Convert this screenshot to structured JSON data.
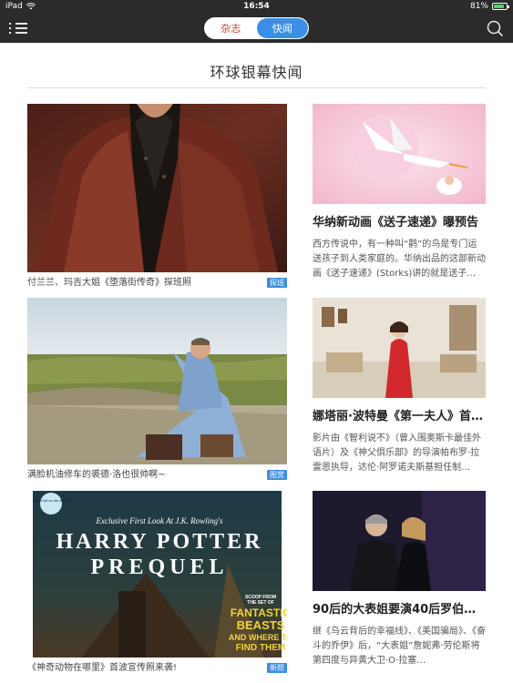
{
  "status": {
    "device": "iPad",
    "time": "16:54",
    "battery": "81%",
    "battery_level": 0.81
  },
  "nav": {
    "tab_magazine": "杂志",
    "tab_news": "快闻",
    "active_tab": "快闻"
  },
  "section": {
    "title": "环球银幕快闻"
  },
  "left_cards": [
    {
      "caption": "付兰兰、玛吉大姐《堕落街传奇》探班照",
      "tag": "探班"
    },
    {
      "caption": "满脸机油修车的裘德·洛也很帅啊~",
      "tag": "图赏"
    },
    {
      "caption": "《神奇动物在哪里》首波宣传照来袭!",
      "tag": "新照",
      "poster": {
        "badge": "Scoot kid on the Block!",
        "exclusive": "Exclusive First Look At J.K. Rowling's",
        "line1": "HARRY POTTER",
        "line2": "PREQUEL",
        "scoop1": "SCOOP FROM",
        "scoop2": "THE SET OF",
        "fb1": "FANTASTIC",
        "fb2": "BEASTS",
        "fb3": "AND WHERE TO",
        "fb4": "FIND THEM"
      }
    }
  ],
  "right_cards": [
    {
      "headline": "华纳新动画《送子速递》曝预告",
      "desc": "西方传说中，有一种叫“鹳”的鸟是专门运送孩子到人类家庭的。华纳出品的这部新动画《送子速递》(Storks)讲的就是送子…"
    },
    {
      "headline": "娜塔丽·波特曼《第一夫人》首…",
      "desc": "影片由《智利说不》（曾入围奥斯卡最佳外语片）及《神父俱乐部》的导演帕布罗·拉雷恩执导，达伦·阿罗诺夫斯基担任制…"
    },
    {
      "headline": "90后的大表姐要演40后罗伯…",
      "desc": "继《乌云背后的幸福线》、《美国骗局》、《奋斗的乔伊》后，“大表姐”詹妮弗·劳伦斯将第四度与异黄大卫·O·拉塞…"
    }
  ],
  "colors": {
    "nav_bg": "#2b2b2b",
    "accent_blue": "#3b8ee6",
    "accent_red": "#d23b3b"
  },
  "icons": [
    "wifi-icon",
    "battery-icon",
    "menu-icon",
    "search-icon"
  ]
}
